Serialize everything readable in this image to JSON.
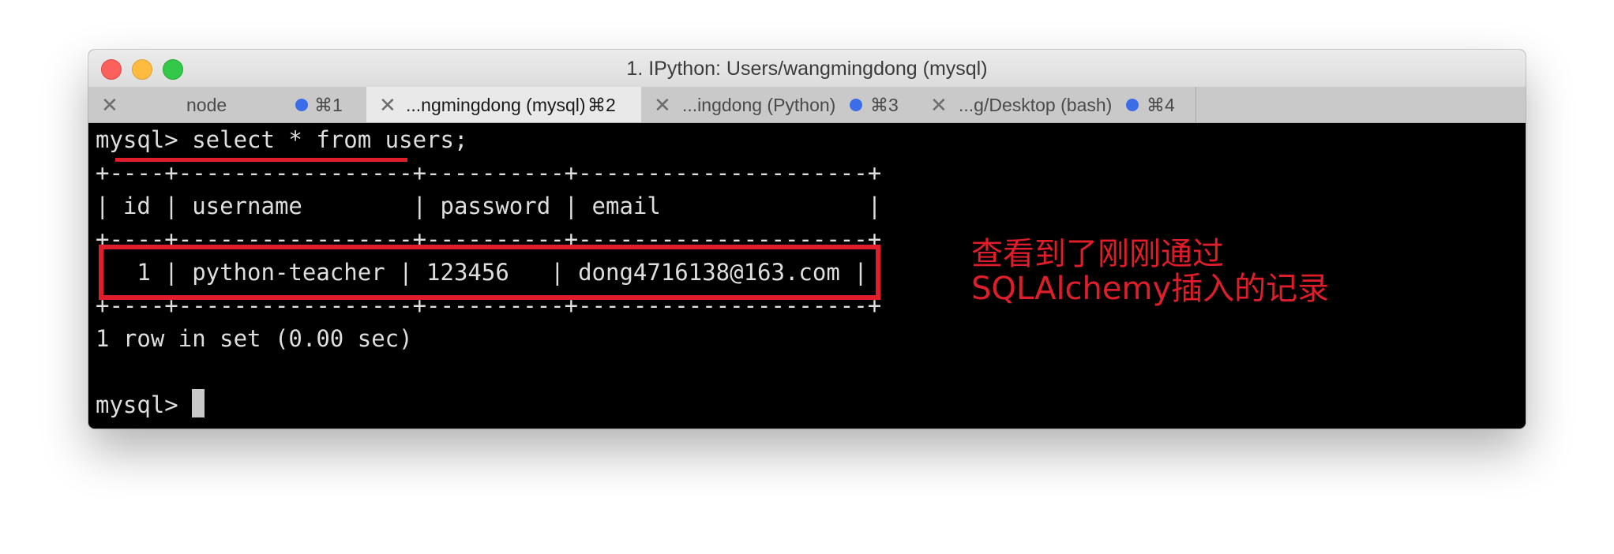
{
  "window": {
    "title": "1. IPython: Users/wangmingdong (mysql)"
  },
  "tabs": [
    {
      "label": "node",
      "shortcut": "⌘1",
      "active": false
    },
    {
      "label": "...ngmingdong (mysql)",
      "shortcut": "⌘2",
      "active": true
    },
    {
      "label": "...ingdong (Python)",
      "shortcut": "⌘3",
      "active": false
    },
    {
      "label": "...g/Desktop (bash)",
      "shortcut": "⌘4",
      "active": false
    }
  ],
  "terminal": {
    "lines": [
      "mysql> select * from users;",
      "+----+-----------------+----------+---------------------+",
      "| id | username        | password | email               |",
      "+----+-----------------+----------+---------------------+",
      "|  1 | python-teacher | 123456   | dong4716138@163.com |",
      "+----+-----------------+----------+---------------------+",
      "1 row in set (0.00 sec)",
      "",
      "mysql> "
    ]
  },
  "annotation": {
    "line1": "查看到了刚刚通过",
    "line2": "SQLAlchemy插入的记录"
  },
  "colors": {
    "annotation": "#e01d2a",
    "tab_dot": "#3c6de8",
    "terminal_bg": "#000000"
  }
}
